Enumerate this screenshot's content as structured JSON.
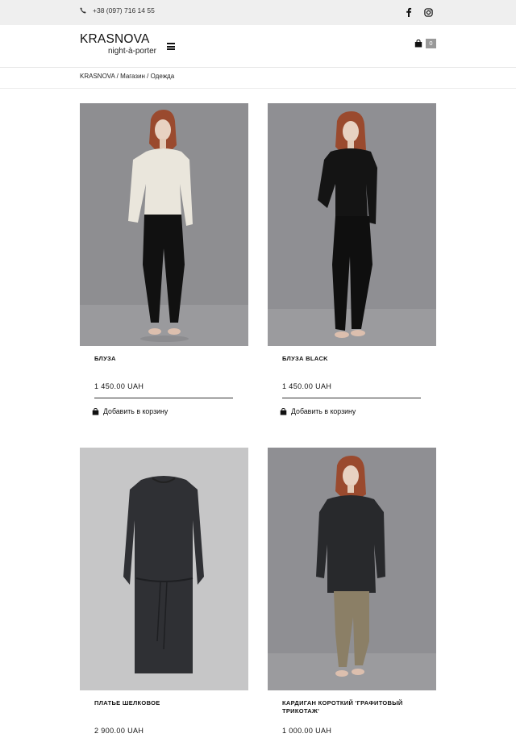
{
  "topbar": {
    "phone": "+38 (097) 716 14 55",
    "social_icons": [
      "facebook-icon",
      "instagram-icon"
    ]
  },
  "header": {
    "logo_main": "KRASNOVA",
    "logo_sub": "night-à-porter",
    "cart_count": "0"
  },
  "breadcrumb": {
    "items": [
      "KRASNOVA",
      "Магазин",
      "Одежда"
    ],
    "separator": " / "
  },
  "products": [
    {
      "name": "БЛУЗА",
      "price": "1 450.00 UAH",
      "add_label": "Добавить в корзину"
    },
    {
      "name": "БЛУЗА BLACK",
      "price": "1 450.00 UAH",
      "add_label": "Добавить в корзину"
    },
    {
      "name": "ПЛАТЬЕ ШЕЛКОВОЕ",
      "price": "2 900.00 UAH"
    },
    {
      "name": "КАРДИГАН КОРОТКИЙ 'ГРАФИТОВЫЙ ТРИКОТАЖ'",
      "price": "1 000.00 UAH"
    }
  ],
  "colors": {
    "topbar_bg": "#efefef",
    "photo_bg": "#8f8f92",
    "text": "#111111",
    "cart_badge": "#999999"
  }
}
